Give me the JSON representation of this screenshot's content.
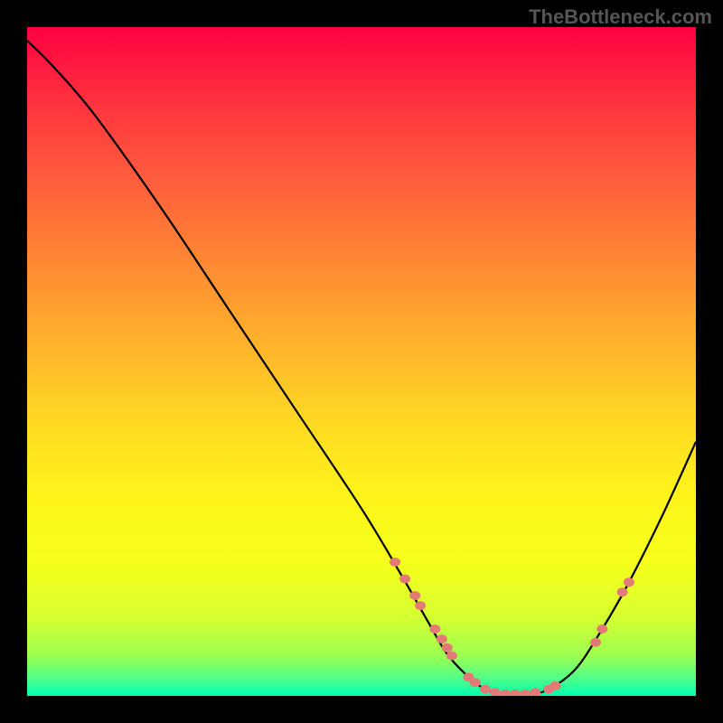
{
  "watermark": "TheBottleneck.com",
  "chart_data": {
    "type": "line",
    "title": "",
    "xlabel": "",
    "ylabel": "",
    "xlim": [
      0,
      100
    ],
    "ylim": [
      0,
      100
    ],
    "series": [
      {
        "name": "curve",
        "points": [
          {
            "x": 0,
            "y": 98
          },
          {
            "x": 4,
            "y": 94
          },
          {
            "x": 10,
            "y": 87
          },
          {
            "x": 20,
            "y": 73
          },
          {
            "x": 30,
            "y": 58
          },
          {
            "x": 40,
            "y": 43
          },
          {
            "x": 50,
            "y": 28
          },
          {
            "x": 56,
            "y": 18
          },
          {
            "x": 60,
            "y": 11
          },
          {
            "x": 63,
            "y": 6
          },
          {
            "x": 67,
            "y": 2
          },
          {
            "x": 70,
            "y": 0.5
          },
          {
            "x": 75,
            "y": 0.3
          },
          {
            "x": 78,
            "y": 1
          },
          {
            "x": 82,
            "y": 4
          },
          {
            "x": 86,
            "y": 10
          },
          {
            "x": 90,
            "y": 17
          },
          {
            "x": 95,
            "y": 27
          },
          {
            "x": 100,
            "y": 38
          }
        ]
      }
    ],
    "markers": [
      {
        "x": 55,
        "y": 20
      },
      {
        "x": 56.5,
        "y": 17.5
      },
      {
        "x": 58,
        "y": 15
      },
      {
        "x": 58.8,
        "y": 13.5
      },
      {
        "x": 61,
        "y": 10
      },
      {
        "x": 62,
        "y": 8.5
      },
      {
        "x": 62.8,
        "y": 7.2
      },
      {
        "x": 63.5,
        "y": 6
      },
      {
        "x": 66,
        "y": 2.8
      },
      {
        "x": 67,
        "y": 2
      },
      {
        "x": 68.5,
        "y": 1
      },
      {
        "x": 70,
        "y": 0.5
      },
      {
        "x": 71.5,
        "y": 0.3
      },
      {
        "x": 73,
        "y": 0.3
      },
      {
        "x": 74.5,
        "y": 0.3
      },
      {
        "x": 76,
        "y": 0.5
      },
      {
        "x": 78,
        "y": 1
      },
      {
        "x": 79,
        "y": 1.5
      },
      {
        "x": 85,
        "y": 8
      },
      {
        "x": 86,
        "y": 10
      },
      {
        "x": 89,
        "y": 15.5
      },
      {
        "x": 90,
        "y": 17
      }
    ],
    "gradient_stops": [
      {
        "pos": 0,
        "color": "#ff0040"
      },
      {
        "pos": 50,
        "color": "#ffc020"
      },
      {
        "pos": 100,
        "color": "#00ffaf"
      }
    ]
  }
}
